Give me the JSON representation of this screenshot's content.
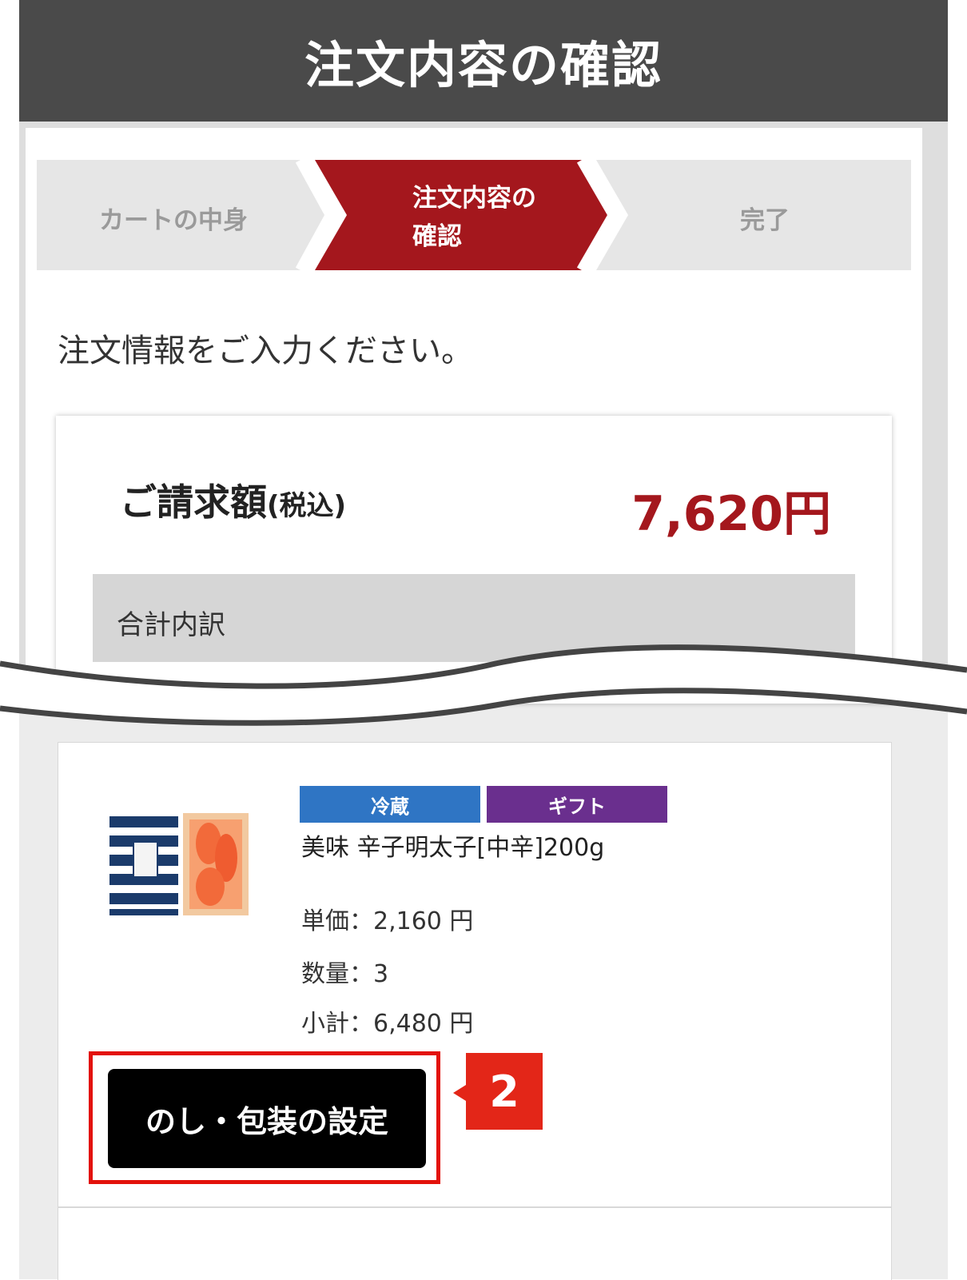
{
  "header": {
    "title": "注文内容の確認"
  },
  "steps": [
    {
      "label": "カートの中身",
      "state": "done"
    },
    {
      "label_line1": "注文内容の",
      "label_line2": "確認",
      "state": "current"
    },
    {
      "label": "完了",
      "state": "todo"
    }
  ],
  "instruction": "注文情報をご入力ください。",
  "summary": {
    "total_label": "ご請求額",
    "tax_note": "(税込)",
    "total_amount": "7,620円",
    "breakdown_label": "合計内訳"
  },
  "item": {
    "tags": {
      "cold": "冷蔵",
      "gift": "ギフト"
    },
    "name": "美味 辛子明太子[中辛]200g",
    "unit_price": "単価：2,160 円",
    "quantity": "数量：3",
    "subtotal": "小計：6,480 円",
    "noshi_button": "のし・包装の設定"
  },
  "callout": {
    "number": "2"
  },
  "colors": {
    "header_bg": "#4a4a4a",
    "step_active": "#a4171d",
    "step_inactive": "#e6e6e6",
    "total_amount": "#a4171d",
    "tag_cold": "#2f75c4",
    "tag_gift": "#6a2f8e",
    "highlight": "#e3120b"
  }
}
